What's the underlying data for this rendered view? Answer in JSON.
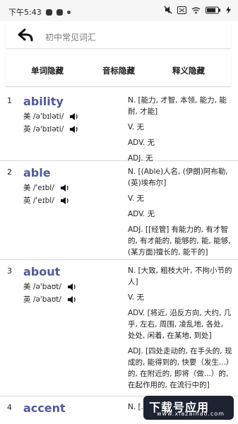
{
  "status_bar": {
    "time": "下午5:43",
    "battery_icon": "battery-icon",
    "wifi_icon": "wifi-icon",
    "signal_icon": "signal-icon"
  },
  "header": {
    "title": "初中常见词汇"
  },
  "controls": {
    "hide_word": "单词隐藏",
    "hide_phonetic": "音标隐藏",
    "hide_meaning": "释义隐藏"
  },
  "entries": [
    {
      "number": "1",
      "word": "ability",
      "us": "美 /ə'bɪləti/",
      "uk": "英 /ə'bɪləti/",
      "defs": [
        "N. [能力, 才智, 本领, 能力, 能耐, 才能]",
        "V. 无",
        "ADV. 无",
        "ADJ. 无"
      ]
    },
    {
      "number": "2",
      "word": "able",
      "us": "美 /'eɪbl/",
      "uk": "英 /'eɪbl/",
      "defs": [
        "N. [(Able)人名, (伊朗)阿布勒, (英)埃布尔]",
        "V. 无",
        "ADV. 无",
        "ADJ. [[经管] 有能力的, 有才智的, 有才能的, 能够的, 能, 能够, (某方面)擅长的, 能干的]"
      ]
    },
    {
      "number": "3",
      "word": "about",
      "us": "美 /ə'baʊt/",
      "uk": "英 /ə'baʊt/",
      "defs": [
        "N. [大致, 粗枝大叶, 不拘小节的人]",
        "V. 无",
        "ADV. [将近, 沿反方向, 大约, 几乎, 左右, 周围, 凌乱地, 各处, 处处, 闲着, 在某地, 到处]",
        "ADJ. [四处走动的, 在手头的, 现成的, 能得到的, 快要（发生...）的, 在附近的, 即将（做...）的, 在起作用的, 在流行中的]"
      ]
    },
    {
      "number": "4",
      "word": "accent",
      "us": "",
      "uk": "",
      "defs": [
        "N. [..."
      ]
    }
  ],
  "watermark": {
    "title": "下载号应用",
    "site": "www.xiazaihao.com"
  },
  "colors": {
    "word": "#4f5a99",
    "status_bg": "#f6f6f6",
    "divider": "#d7d7d7"
  }
}
